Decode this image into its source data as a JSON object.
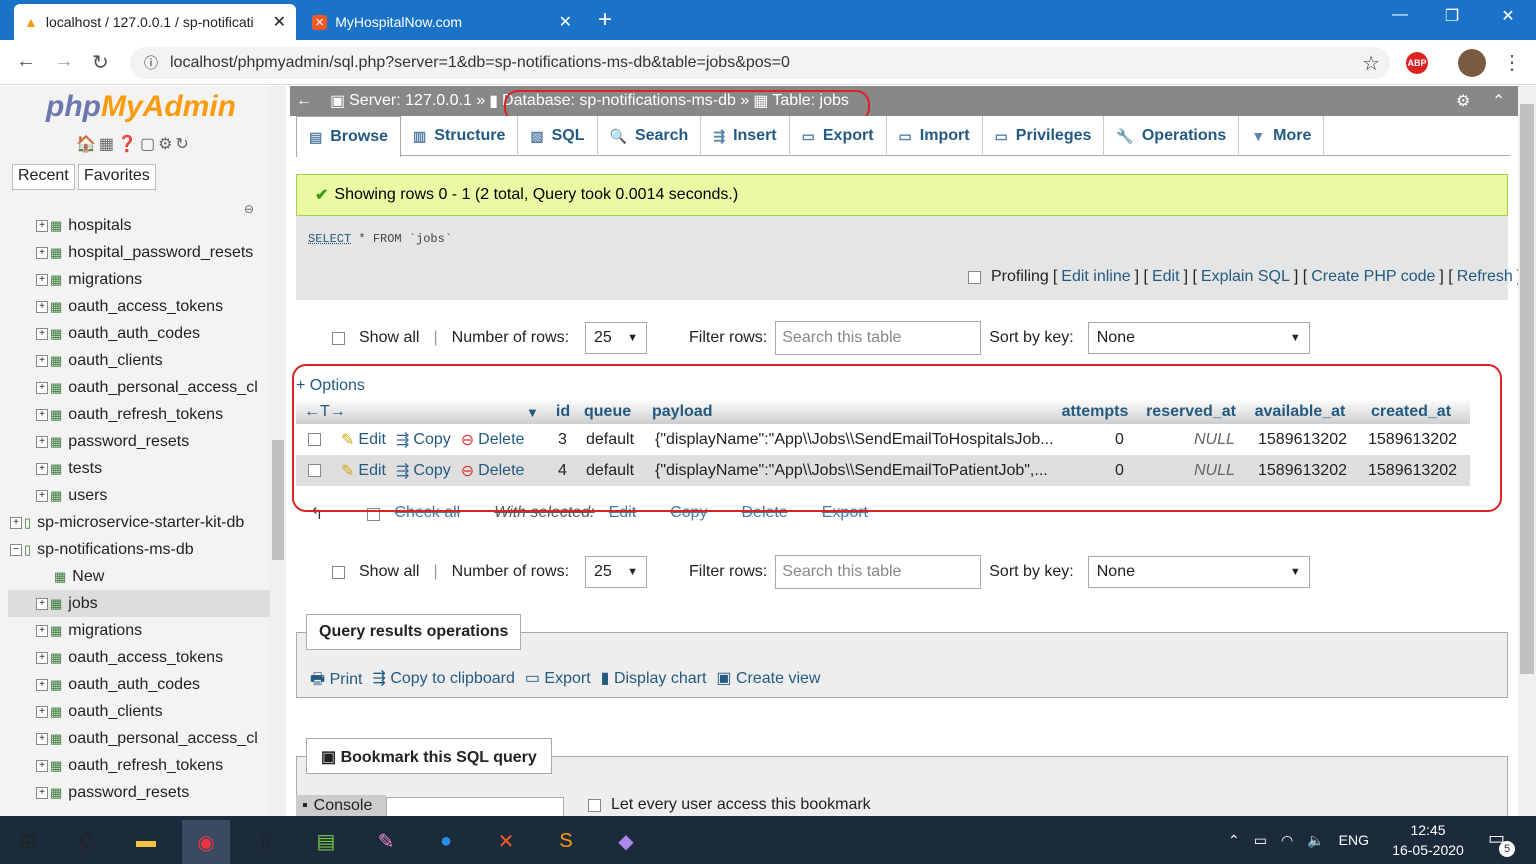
{
  "browser": {
    "tab1_title": "localhost / 127.0.0.1 / sp-notificati",
    "tab2_title": "MyHospitalNow.com",
    "url": "localhost/phpmyadmin/sql.php?server=1&db=sp-notifications-ms-db&table=jobs&pos=0"
  },
  "sidebar": {
    "logo_php": "php",
    "logo_myadmin": "MyAdmin",
    "recent": "Recent",
    "favorites": "Favorites",
    "items": [
      {
        "label": "hospitals",
        "level": 2
      },
      {
        "label": "hospital_password_resets",
        "level": 2
      },
      {
        "label": "migrations",
        "level": 2
      },
      {
        "label": "oauth_access_tokens",
        "level": 2
      },
      {
        "label": "oauth_auth_codes",
        "level": 2
      },
      {
        "label": "oauth_clients",
        "level": 2
      },
      {
        "label": "oauth_personal_access_cl",
        "level": 2
      },
      {
        "label": "oauth_refresh_tokens",
        "level": 2
      },
      {
        "label": "password_resets",
        "level": 2
      },
      {
        "label": "tests",
        "level": 2
      },
      {
        "label": "users",
        "level": 2
      },
      {
        "label": "sp-microservice-starter-kit-db",
        "level": 1
      },
      {
        "label": "sp-notifications-ms-db",
        "level": 1
      },
      {
        "label": "New",
        "level": 2
      },
      {
        "label": "jobs",
        "level": 2,
        "selected": true
      },
      {
        "label": "migrations",
        "level": 2
      },
      {
        "label": "oauth_access_tokens",
        "level": 2
      },
      {
        "label": "oauth_auth_codes",
        "level": 2
      },
      {
        "label": "oauth_clients",
        "level": 2
      },
      {
        "label": "oauth_personal_access_cl",
        "level": 2
      },
      {
        "label": "oauth_refresh_tokens",
        "level": 2
      },
      {
        "label": "password_resets",
        "level": 2
      }
    ]
  },
  "breadcrumb": {
    "server": "Server: 127.0.0.1 »",
    "database": "Database: sp-notifications-ms-db »",
    "table": "Table: jobs"
  },
  "tabs": [
    "Browse",
    "Structure",
    "SQL",
    "Search",
    "Insert",
    "Export",
    "Import",
    "Privileges",
    "Operations",
    "More"
  ],
  "message": "Showing rows 0 - 1 (2 total, Query took 0.0014 seconds.)",
  "sql": {
    "select": "SELECT",
    "rest": " * FROM `jobs`"
  },
  "profiling": {
    "label": "Profiling",
    "edit_inline": "Edit inline",
    "edit": "Edit",
    "explain": "Explain SQL",
    "php": "Create PHP code",
    "refresh": "Refresh"
  },
  "controls": {
    "show_all": "Show all",
    "num_rows_label": "Number of rows:",
    "num_rows": "25",
    "filter_label": "Filter rows:",
    "filter_placeholder": "Search this table",
    "sort_label": "Sort by key:",
    "sort_value": "None"
  },
  "options_link": "+ Options",
  "columns": [
    "id",
    "queue",
    "payload",
    "attempts",
    "reserved_at",
    "available_at",
    "created_at"
  ],
  "rows": [
    {
      "id": "3",
      "queue": "default",
      "payload": "{\"displayName\":\"App\\\\Jobs\\\\SendEmailToHospitalsJob...",
      "attempts": "0",
      "reserved_at": "NULL",
      "available_at": "1589613202",
      "created_at": "1589613202"
    },
    {
      "id": "4",
      "queue": "default",
      "payload": "{\"displayName\":\"App\\\\Jobs\\\\SendEmailToPatientJob\",...",
      "attempts": "0",
      "reserved_at": "NULL",
      "available_at": "1589613202",
      "created_at": "1589613202"
    }
  ],
  "row_actions": {
    "edit": "Edit",
    "copy": "Copy",
    "delete": "Delete"
  },
  "with_selected": {
    "check_all": "Check all",
    "label": "With selected:",
    "edit": "Edit",
    "copy": "Copy",
    "delete": "Delete",
    "export": "Export"
  },
  "query_ops": {
    "title": "Query results operations",
    "print": "Print",
    "copy": "Copy to clipboard",
    "export": "Export",
    "chart": "Display chart",
    "view": "Create view"
  },
  "bookmark": {
    "title": "Bookmark this SQL query",
    "let_every": "Let every user access this bookmark"
  },
  "console": "Console",
  "taskbar": {
    "lang": "ENG",
    "time": "12:45",
    "date": "16-05-2020",
    "notif": "5"
  }
}
